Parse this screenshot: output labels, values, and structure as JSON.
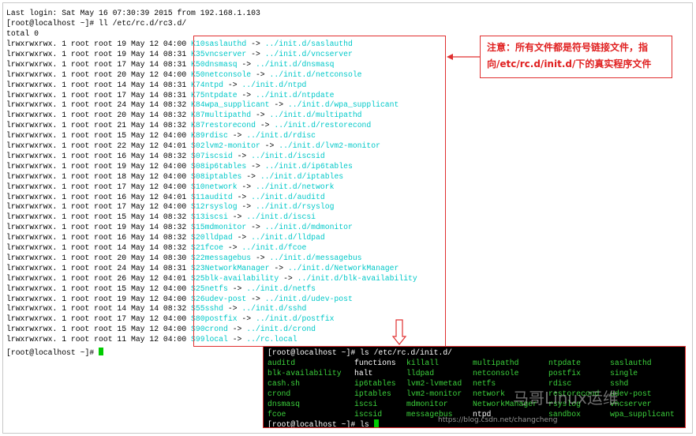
{
  "terminal": {
    "last_login": "Last login: Sat May 16 07:30:39 2015 from 192.168.1.103",
    "prompt_cmd": "[root@localhost ~]# ll /etc/rc.d/rc3.d/",
    "total": "total 0",
    "entries": [
      {
        "meta": "lrwxrwxrwx. 1 root root 19 May 12 04:00",
        "name": "K10saslauthd",
        "target": "../init.d/saslauthd"
      },
      {
        "meta": "lrwxrwxrwx. 1 root root 19 May 14 08:31",
        "name": "K35vncserver",
        "target": "../init.d/vncserver"
      },
      {
        "meta": "lrwxrwxrwx. 1 root root 17 May 14 08:31",
        "name": "K50dnsmasq",
        "target": "../init.d/dnsmasq"
      },
      {
        "meta": "lrwxrwxrwx. 1 root root 20 May 12 04:00",
        "name": "K50netconsole",
        "target": "../init.d/netconsole"
      },
      {
        "meta": "lrwxrwxrwx. 1 root root 14 May 14 08:31",
        "name": "K74ntpd",
        "target": "../init.d/ntpd"
      },
      {
        "meta": "lrwxrwxrwx. 1 root root 17 May 14 08:31",
        "name": "K75ntpdate",
        "target": "../init.d/ntpdate"
      },
      {
        "meta": "lrwxrwxrwx. 1 root root 24 May 14 08:32",
        "name": "K84wpa_supplicant",
        "target": "../init.d/wpa_supplicant"
      },
      {
        "meta": "lrwxrwxrwx. 1 root root 20 May 14 08:32",
        "name": "K87multipathd",
        "target": "../init.d/multipathd"
      },
      {
        "meta": "lrwxrwxrwx. 1 root root 21 May 14 08:32",
        "name": "K87restorecond",
        "target": "../init.d/restorecond"
      },
      {
        "meta": "lrwxrwxrwx. 1 root root 15 May 12 04:00",
        "name": "K89rdisc",
        "target": "../init.d/rdisc"
      },
      {
        "meta": "lrwxrwxrwx. 1 root root 22 May 12 04:01",
        "name": "S02lvm2-monitor",
        "target": "../init.d/lvm2-monitor"
      },
      {
        "meta": "lrwxrwxrwx. 1 root root 16 May 14 08:32",
        "name": "S07iscsid",
        "target": "../init.d/iscsid"
      },
      {
        "meta": "lrwxrwxrwx. 1 root root 19 May 12 04:00",
        "name": "S08ip6tables",
        "target": "../init.d/ip6tables"
      },
      {
        "meta": "lrwxrwxrwx. 1 root root 18 May 12 04:00",
        "name": "S08iptables",
        "target": "../init.d/iptables"
      },
      {
        "meta": "lrwxrwxrwx. 1 root root 17 May 12 04:00",
        "name": "S10network",
        "target": "../init.d/network"
      },
      {
        "meta": "lrwxrwxrwx. 1 root root 16 May 12 04:01",
        "name": "S11auditd",
        "target": "../init.d/auditd"
      },
      {
        "meta": "lrwxrwxrwx. 1 root root 17 May 12 04:00",
        "name": "S12rsyslog",
        "target": "../init.d/rsyslog"
      },
      {
        "meta": "lrwxrwxrwx. 1 root root 15 May 14 08:32",
        "name": "S13iscsi",
        "target": "../init.d/iscsi"
      },
      {
        "meta": "lrwxrwxrwx. 1 root root 19 May 14 08:32",
        "name": "S15mdmonitor",
        "target": "../init.d/mdmonitor"
      },
      {
        "meta": "lrwxrwxrwx. 1 root root 16 May 14 08:32",
        "name": "S20lldpad",
        "target": "../init.d/lldpad"
      },
      {
        "meta": "lrwxrwxrwx. 1 root root 14 May 14 08:32",
        "name": "S21fcoe",
        "target": "../init.d/fcoe"
      },
      {
        "meta": "lrwxrwxrwx. 1 root root 20 May 14 08:30",
        "name": "S22messagebus",
        "target": "../init.d/messagebus"
      },
      {
        "meta": "lrwxrwxrwx. 1 root root 24 May 14 08:31",
        "name": "S23NetworkManager",
        "target": "../init.d/NetworkManager"
      },
      {
        "meta": "lrwxrwxrwx. 1 root root 26 May 12 04:01",
        "name": "S25blk-availability",
        "target": "../init.d/blk-availability"
      },
      {
        "meta": "lrwxrwxrwx. 1 root root 15 May 12 04:00",
        "name": "S25netfs",
        "target": "../init.d/netfs"
      },
      {
        "meta": "lrwxrwxrwx. 1 root root 19 May 12 04:00",
        "name": "S26udev-post",
        "target": "../init.d/udev-post"
      },
      {
        "meta": "lrwxrwxrwx. 1 root root 14 May 14 08:32",
        "name": "S55sshd",
        "target": "../init.d/sshd"
      },
      {
        "meta": "lrwxrwxrwx. 1 root root 17 May 12 04:00",
        "name": "S80postfix",
        "target": "../init.d/postfix"
      },
      {
        "meta": "lrwxrwxrwx. 1 root root 15 May 12 04:00",
        "name": "S90crond",
        "target": "../init.d/crond"
      },
      {
        "meta": "lrwxrwxrwx. 1 root root 11 May 12 04:00",
        "name": "S99local",
        "target": "../rc.local"
      }
    ],
    "final_prompt": "[root@localhost ~]#",
    "colors": {
      "link": "#00c8c8",
      "cursor": "#00cc00",
      "annotation": "#e03030"
    }
  },
  "note": {
    "line1": "注意：所有文件都是符号链接文件，指",
    "line2": "向/etc/rc.d/init.d/下的真实程序文件"
  },
  "init_panel": {
    "prompt_cmd": "[root@localhost ~]# ls /etc/rc.d/init.d/",
    "rows": [
      [
        "auditd",
        "functions",
        "killall",
        "multipathd",
        "ntpdate",
        "saslauthd"
      ],
      [
        "blk-availability",
        "halt",
        "lldpad",
        "netconsole",
        "postfix",
        "single"
      ],
      [
        "cash.sh",
        "ip6tables",
        "lvm2-lvmetad",
        "netfs",
        "rdisc",
        "sshd"
      ],
      [
        "crond",
        "iptables",
        "lvm2-monitor",
        "network",
        "restorecond",
        "udev-post"
      ],
      [
        "dnsmasq",
        "iscsi",
        "mdmonitor",
        "NetworkManager",
        "rsyslog",
        "vncserver"
      ],
      [
        "fcoe",
        "iscsid",
        "messagebus",
        "ntpd",
        "sandbox",
        "wpa_supplicant"
      ]
    ],
    "final_prompt": "[root@localhost ~]# ls"
  },
  "watermark": {
    "brand": "马哥Linux运维",
    "url": "https://blog.csdn.net/changcheng"
  }
}
